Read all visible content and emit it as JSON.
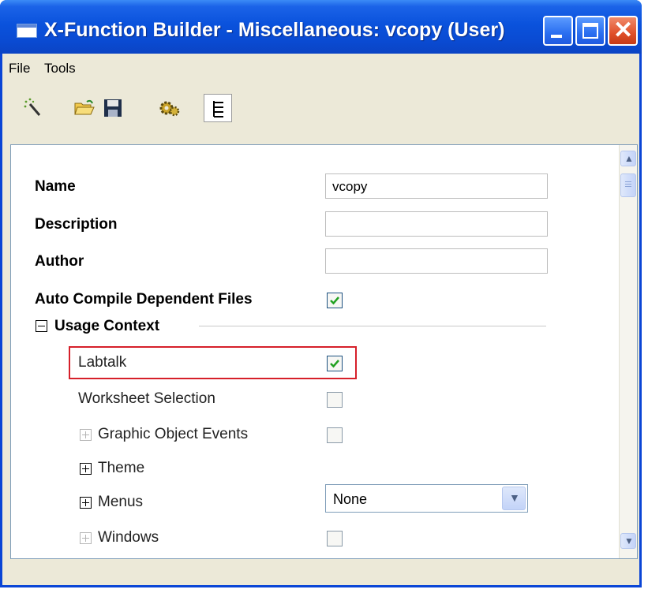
{
  "window": {
    "title": "X-Function Builder - Miscellaneous: vcopy (User)",
    "accent": "#0A4BD3"
  },
  "menu": {
    "file": "File",
    "tools": "Tools"
  },
  "toolbar": {
    "icons": [
      "new-wand-icon",
      "open-folder-icon",
      "save-disk-icon",
      "compile-gear-icon",
      "tree-view-icon"
    ]
  },
  "properties": {
    "name": {
      "label": "Name",
      "value": "vcopy"
    },
    "description": {
      "label": "Description",
      "value": ""
    },
    "author": {
      "label": "Author",
      "value": ""
    },
    "auto_compile": {
      "label": "Auto Compile Dependent Files",
      "checked": true
    },
    "usage_context": {
      "label": "Usage Context",
      "labtalk": {
        "label": "Labtalk",
        "checked": true
      },
      "worksheet_selection": {
        "label": "Worksheet Selection",
        "checked": false
      },
      "graphic_object_events": {
        "label": "Graphic Object Events",
        "checked": false
      },
      "theme": {
        "label": "Theme"
      },
      "menus": {
        "label": "Menus",
        "value": "None"
      },
      "windows": {
        "label": "Windows",
        "checked": false
      }
    }
  },
  "highlight_color": "#d6202a"
}
